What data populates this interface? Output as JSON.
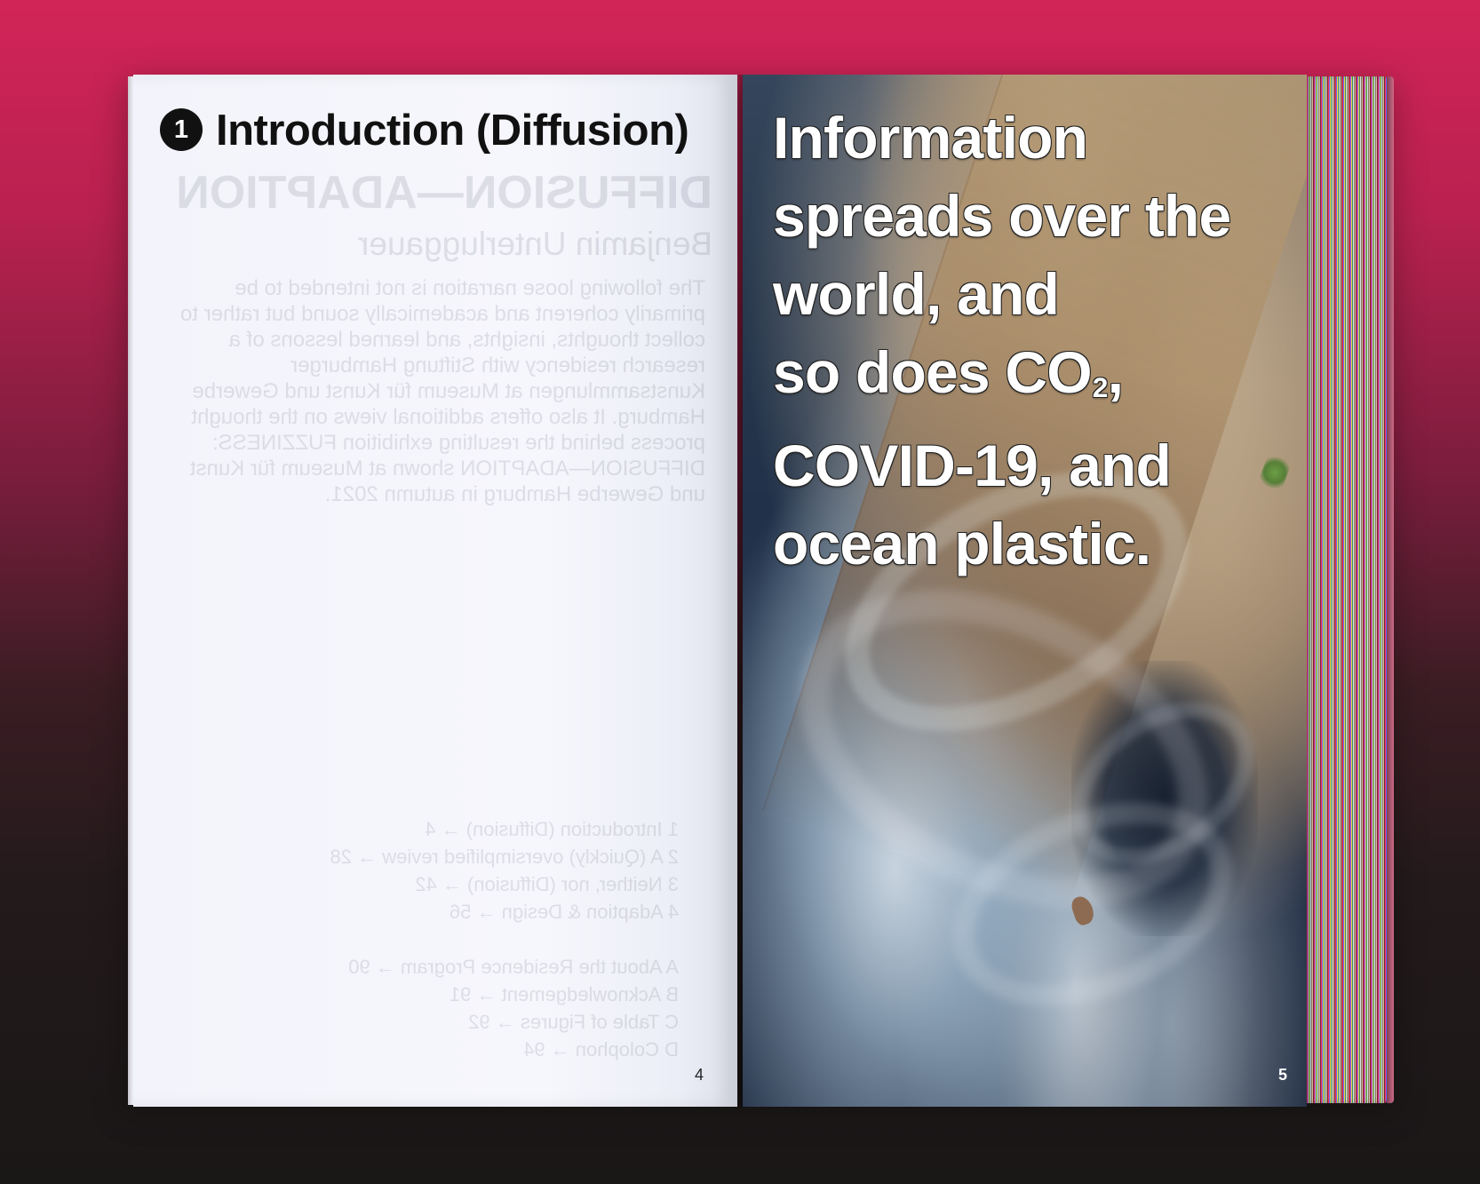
{
  "left_page": {
    "chapter_number": "1",
    "chapter_title": "Introduction (Diffusion)",
    "page_number": "4"
  },
  "right_page": {
    "headline_lines": [
      "Information",
      "spreads over the",
      "world, and",
      "so does CO",
      "COVID-19, and",
      "ocean plastic."
    ],
    "co2_subscript": "2",
    "co2_suffix": ",",
    "page_number": "5"
  },
  "colors": {
    "background_top": "#d22457",
    "background_bottom": "#1a1717",
    "left_page": "#f5f6fc",
    "headline_text": "#ffffff"
  }
}
